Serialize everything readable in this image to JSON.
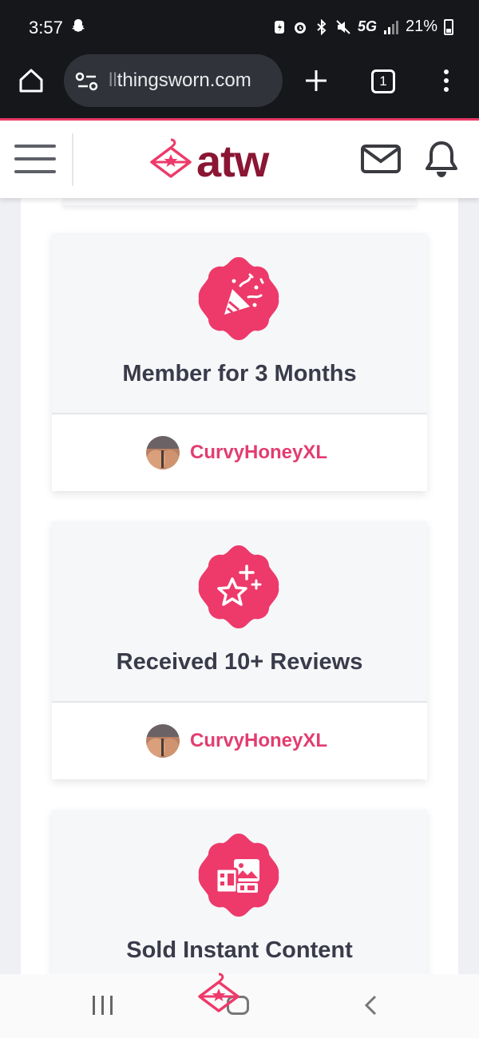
{
  "status_bar": {
    "time": "3:57",
    "network": "5G",
    "battery": "21%"
  },
  "browser": {
    "url_faded": "ll",
    "url_text": "thingsworn.com",
    "tab_count": "1"
  },
  "header": {
    "logo_text": "atw"
  },
  "badges": [
    {
      "title": "Member for 3 Months",
      "icon": "party-popper-icon",
      "user": "CurvyHoneyXL"
    },
    {
      "title": "Received 10+ Reviews",
      "icon": "sparkle-star-icon",
      "user": "CurvyHoneyXL"
    },
    {
      "title": "Sold Instant Content",
      "icon": "image-gallery-icon",
      "user": ""
    }
  ],
  "colors": {
    "accent": "#ed3a6a",
    "logo_dark": "#8a1634",
    "badge_title": "#3a3b4a",
    "user_name": "#e23d70"
  }
}
